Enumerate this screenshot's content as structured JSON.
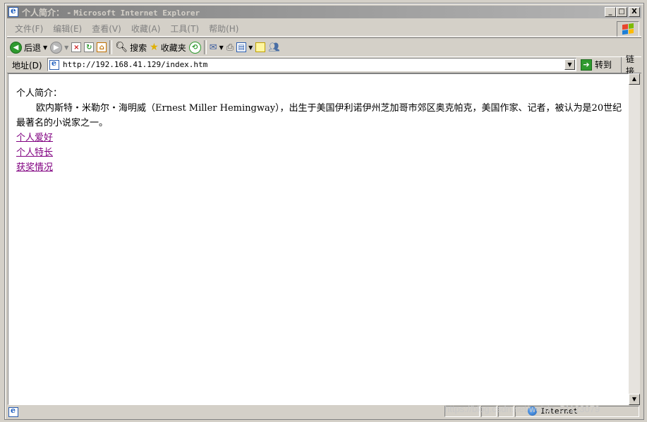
{
  "window": {
    "title": "个人简介：",
    "title_sep": " - ",
    "app_name": "Microsoft Internet Explorer",
    "buttons": {
      "minimize": "_",
      "maximize": "□",
      "close": "X"
    }
  },
  "menu": {
    "items": [
      "文件(F)",
      "编辑(E)",
      "查看(V)",
      "收藏(A)",
      "工具(T)",
      "帮助(H)"
    ]
  },
  "toolbar": {
    "back_label": "后退",
    "search_label": "搜索",
    "favorites_label": "收藏夹"
  },
  "address": {
    "label": "地址(D)",
    "url": "http://192.168.41.129/index.htm",
    "go_label": "转到",
    "links_label": "链接"
  },
  "page": {
    "heading": "个人简介：",
    "paragraph": "欧内斯特・米勒尔・海明威（Ernest Miller Hemingway），出生于美国伊利诺伊州芝加哥市郊区奥克帕克，美国作家、记者，被认为是20世纪最著名的小说家之一。",
    "links": [
      "个人爱好",
      "个人特长",
      "获奖情况"
    ]
  },
  "status": {
    "zone": "Internet"
  },
  "watermark": "https://blog.csdn.net/weixin_51123079",
  "colors": {
    "visited_link": "#800080",
    "title_gradient_start": "#808080",
    "chrome": "#d4d0c8"
  }
}
